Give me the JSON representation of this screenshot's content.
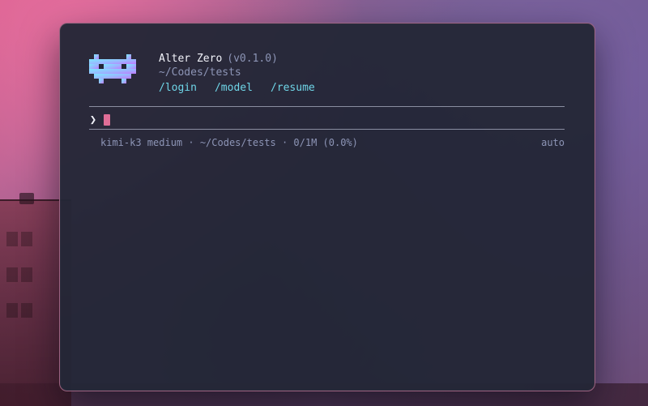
{
  "app": {
    "name": "Alter Zero",
    "version": "(v0.1.0)",
    "cwd": "~/Codes/tests"
  },
  "commands": [
    {
      "label": "/login"
    },
    {
      "label": "/model"
    },
    {
      "label": "/resume"
    }
  ],
  "prompt": {
    "symbol": "❯",
    "value": ""
  },
  "status": {
    "left": "kimi-k3 medium · ~/Codes/tests · 0/1M (0.0%)",
    "right": "auto"
  },
  "theme": {
    "accent_cyan": "#6fd6e8",
    "cursor_pink": "#e06e97",
    "muted_text": "#8d95b6",
    "terminal_bg": "#232636"
  },
  "icons": {
    "logo": "pixel-invader-icon"
  }
}
